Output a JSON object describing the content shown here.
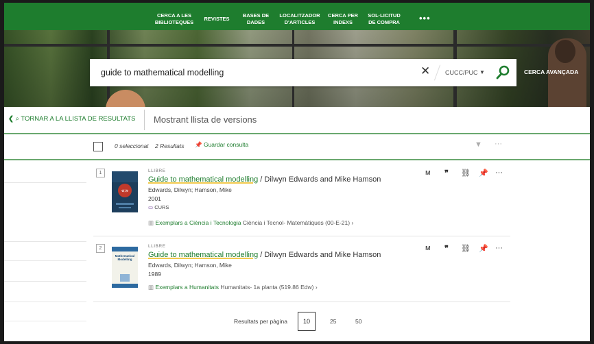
{
  "nav": {
    "items": [
      {
        "label": "CERCA A LES BIBLIOTEQUES"
      },
      {
        "label": "REVISTES"
      },
      {
        "label": "BASES DE DADES"
      },
      {
        "label": "LOCALITZADOR D'ARTICLES"
      },
      {
        "label": "CERCA PER INDEXS"
      },
      {
        "label": "SOL·LICITUD DE COMPRA"
      }
    ],
    "more": "•••"
  },
  "search": {
    "query": "guide to mathematical modelling",
    "scope": "CUCC/PUC",
    "advanced": "CERCA AVANÇADA"
  },
  "back": {
    "label": "TORNAR A LA LLISTA DE RESULTATS",
    "heading": "Mostrant llista de versions"
  },
  "toolbar": {
    "selected": "0 seleccionat",
    "results": "2 Resultats",
    "save": "Guardar consulta"
  },
  "records": [
    {
      "num": "1",
      "type": "LLIBRE",
      "title_link": "Guide to mathematical modelling",
      "title_rest": " / Dilwyn Edwards and Mike Hamson",
      "authors": "Edwards, Dilwyn; Hamson, Mike",
      "year": "2001",
      "tag": "CURS",
      "avail_link": "Exemplars a Ciència i Tecnologia",
      "avail_loc": "Ciència i Tecnol- Matemàtiques (00-E-21)"
    },
    {
      "num": "2",
      "type": "LLIBRE",
      "title_link": "Guide to mathematical modelling",
      "title_rest": " / Dilwyn Edwards and Mike Hamson",
      "authors": "Edwards, Dilwyn; Hamson, Mike",
      "year": "1989",
      "avail_link": "Exemplars a Humanitats",
      "avail_loc": "Humanitats- 1a planta (519.86 Edw)",
      "cover_text": "Mathematical Modelling"
    }
  ],
  "pager": {
    "label": "Resultats per pàgina",
    "options": [
      "10",
      "25",
      "50"
    ]
  },
  "colors": {
    "brand": "#1e7d2e",
    "highlight": "#f2c94c"
  }
}
